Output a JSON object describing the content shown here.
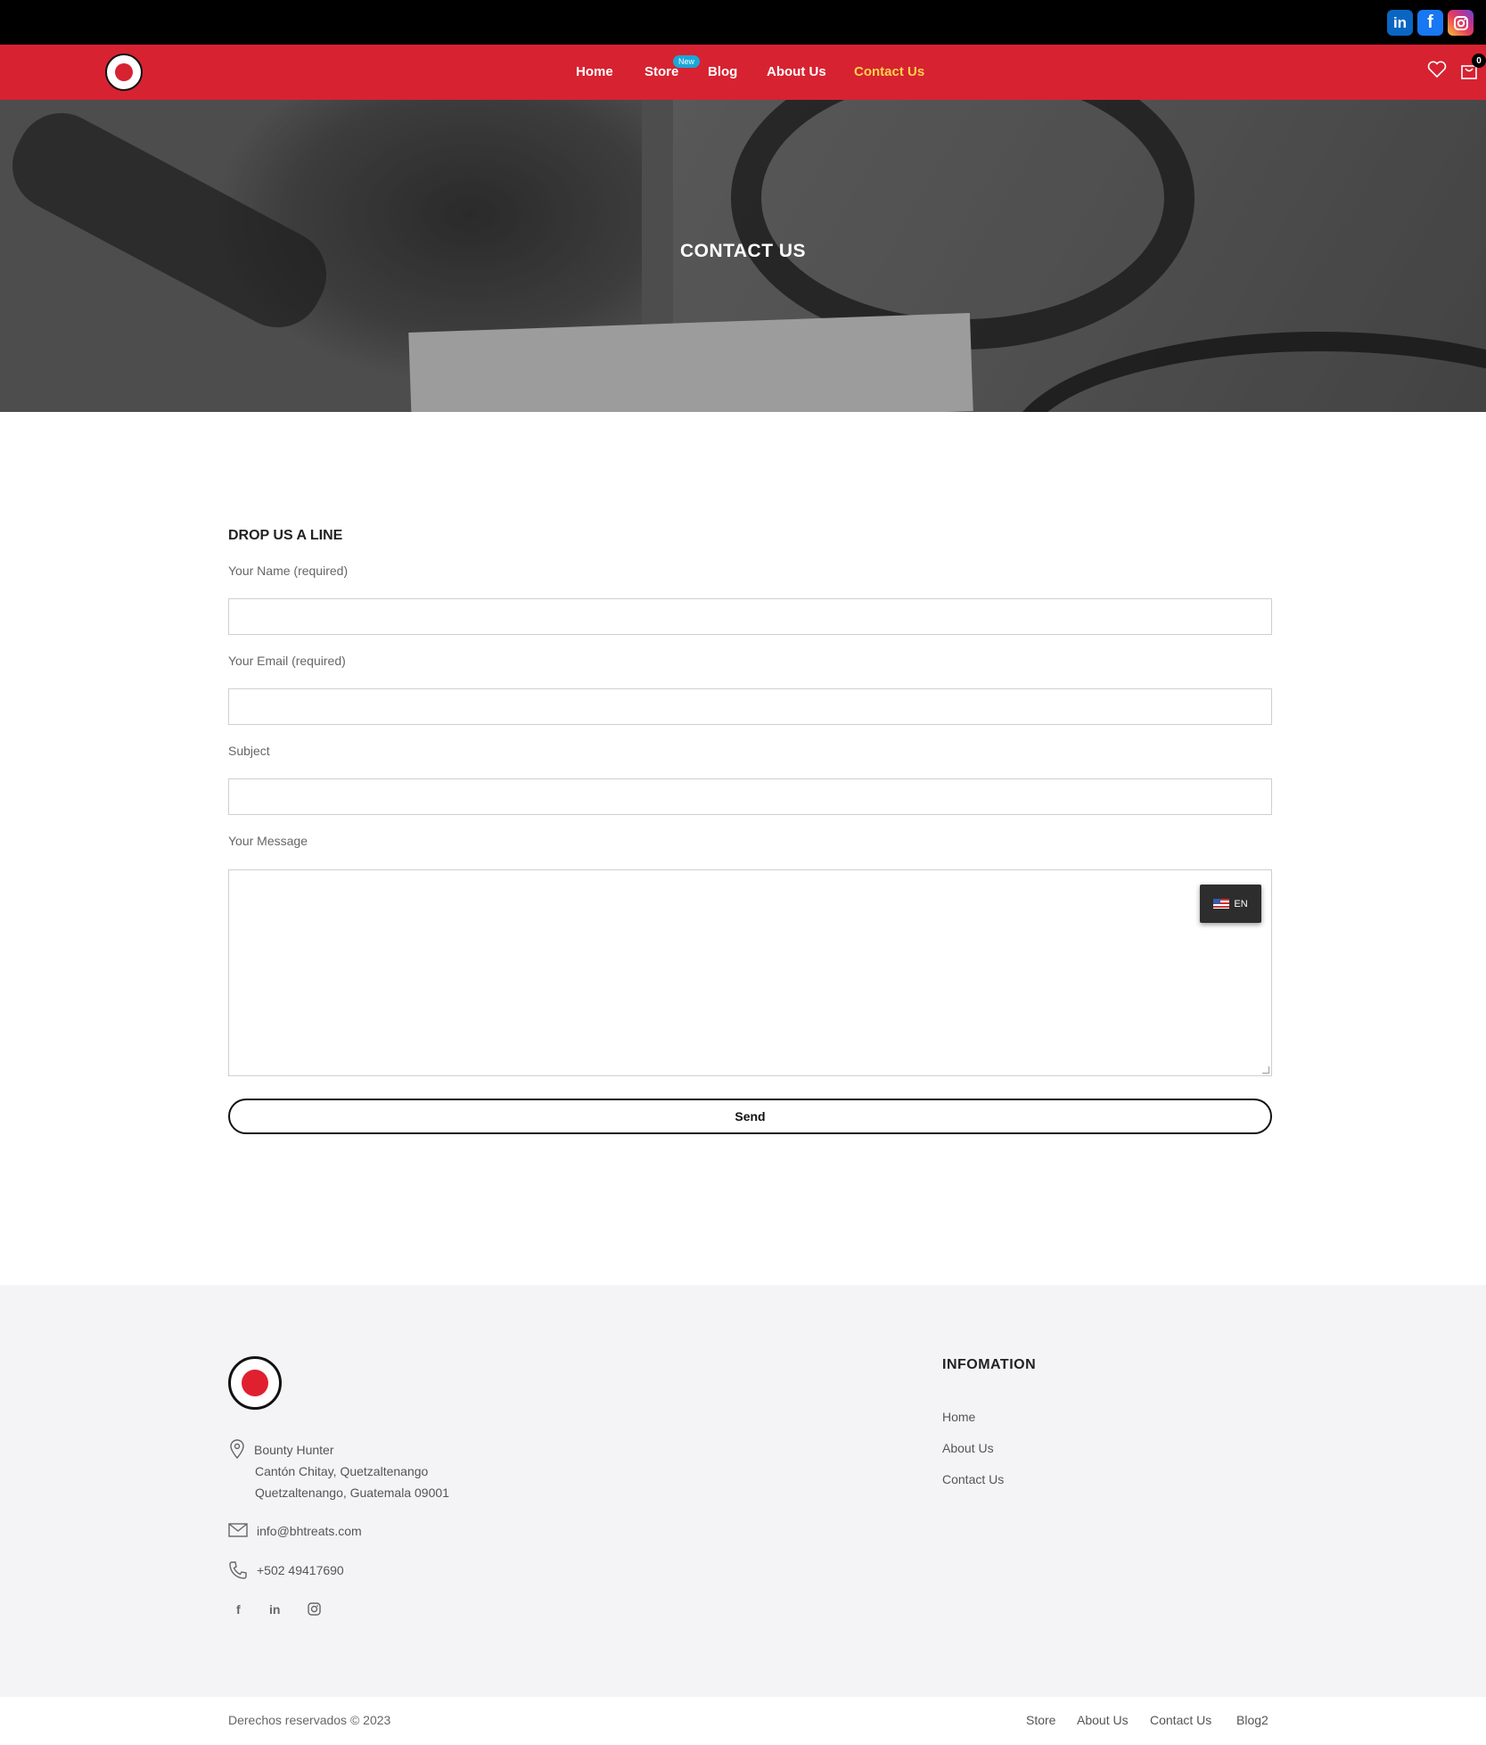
{
  "social_top": [
    "in",
    "f",
    "ig"
  ],
  "nav": {
    "logo_alt": "Bounty Hunter",
    "links": [
      "Home",
      "Store",
      "Blog",
      "About Us",
      "Contact Us"
    ],
    "store_badge": "New",
    "cart_count": "0",
    "active": "Contact Us"
  },
  "hero": {
    "title": "CONTACT US"
  },
  "form": {
    "title": "DROP US A LINE",
    "name_label": "Your Name (required)",
    "email_label": "Your Email (required)",
    "subject_label": "Subject",
    "message_label": "Your Message",
    "send_label": "Send",
    "lang_label": "EN"
  },
  "footer": {
    "address_lines": [
      "Bounty Hunter",
      "Cantón Chitay, Quetzaltenango",
      "Quetzaltenango, Guatemala 09001"
    ],
    "email": "info@bhtreats.com",
    "phone": "+502 49417690",
    "social": [
      "f",
      "in",
      "ig"
    ],
    "info_title": "INFOMATION",
    "info_links": [
      "Home",
      "About Us",
      "Contact Us"
    ],
    "copyright": "Derechos reservados © 2023",
    "bottom_links": [
      "Store",
      "About Us",
      "Contact Us",
      "Blog2"
    ]
  },
  "colors": {
    "brand_red": "#d72231",
    "active_link": "#ffd24c",
    "badge_blue": "#1aa7d9"
  }
}
